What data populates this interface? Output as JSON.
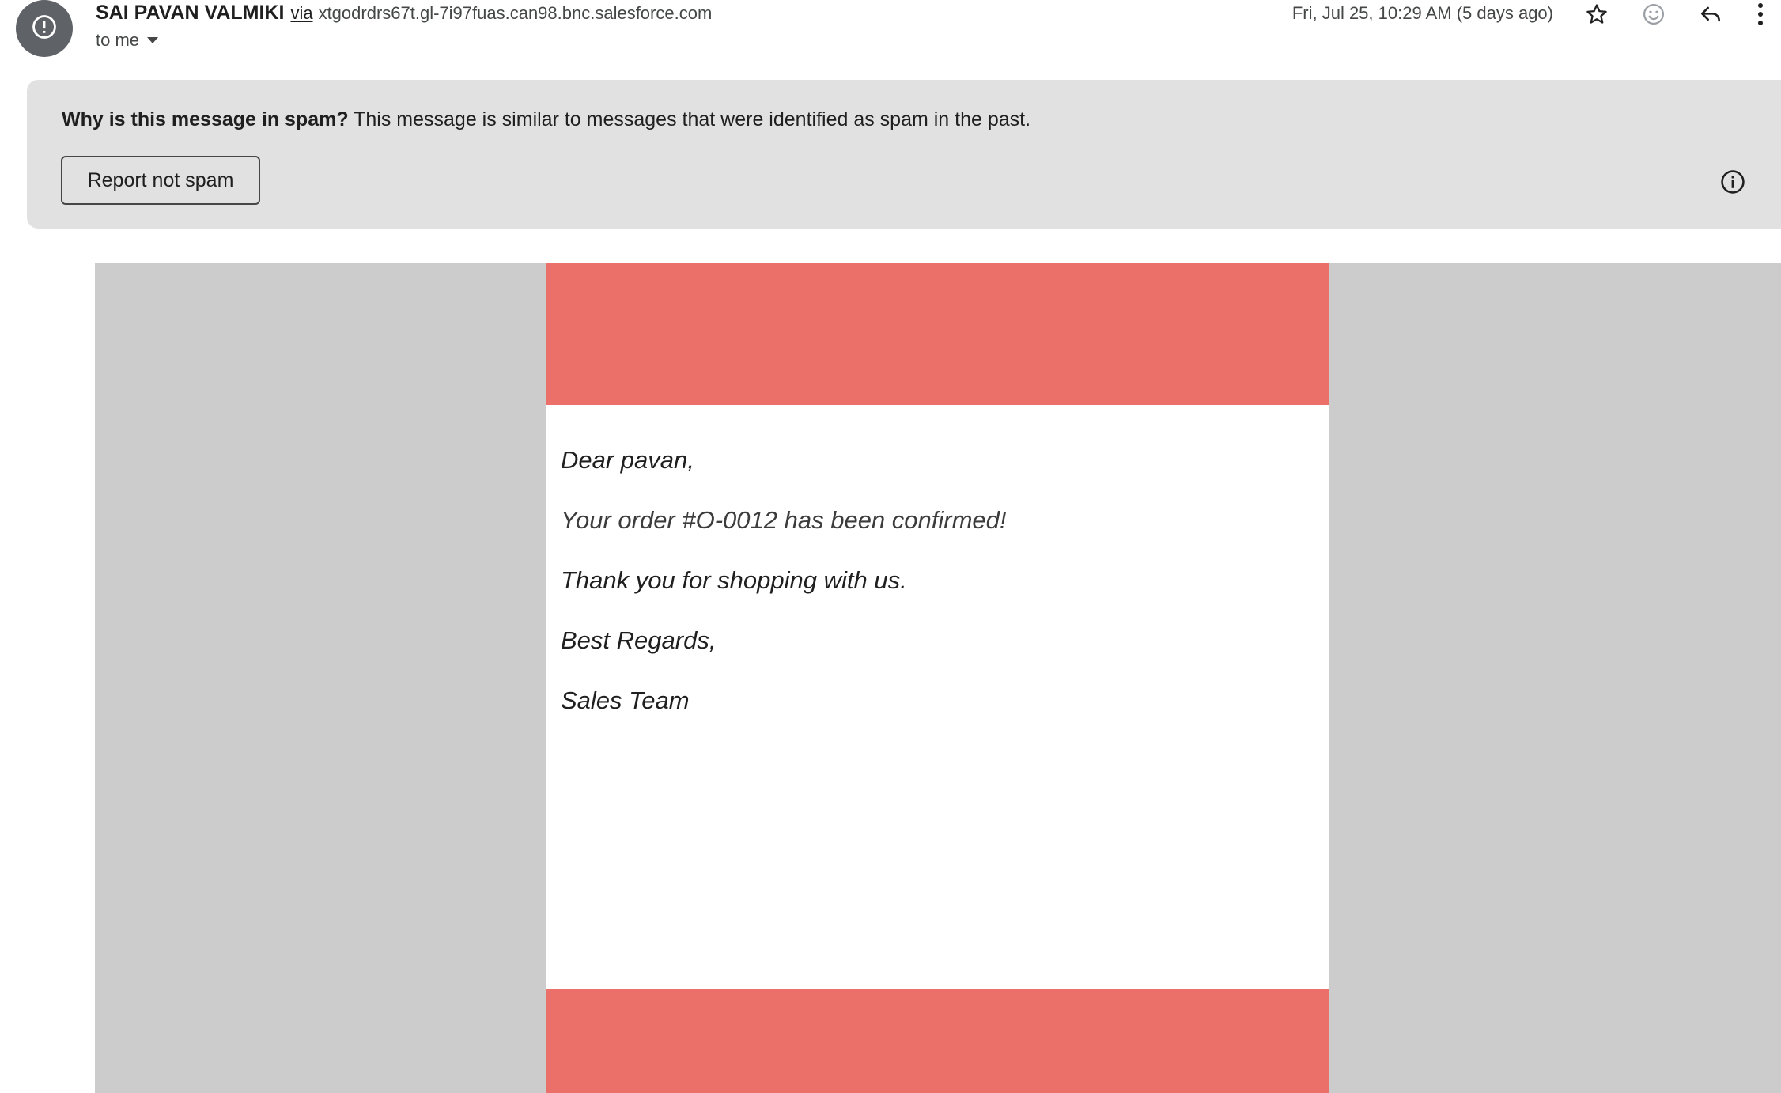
{
  "header": {
    "sender_name": "SAI PAVAN VALMIKI",
    "via_label": "via",
    "sender_domain": "xtgodrdrs67t.gl-7i97fuas.can98.bnc.salesforce.com",
    "recipient_label": "to me",
    "timestamp": "Fri, Jul 25, 10:29 AM (5 days ago)",
    "icons": [
      "alert-icon",
      "star-icon",
      "emoji-icon",
      "reply-icon",
      "more-vert-icon"
    ]
  },
  "spam_banner": {
    "question": "Why is this message in spam?",
    "explanation": "This message is similar to messages that were identified as spam in the past.",
    "report_button_label": "Report not spam",
    "icon": "info-icon"
  },
  "email_body": {
    "greeting": "Dear pavan,",
    "order_line": "Your order #O-0012 has been confirmed!",
    "thanks_line": "Thank you for shopping with us.",
    "signoff": "Best Regards,",
    "signature": "Sales Team"
  },
  "colors": {
    "accent_band": "#ec706a",
    "banner_bg": "#e1e1e1",
    "email_bg": "#cccccc",
    "avatar_bg": "#5f6368"
  }
}
